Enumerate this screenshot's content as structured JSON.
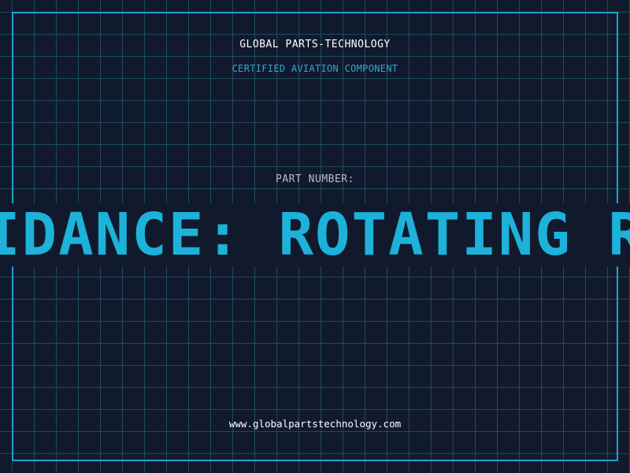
{
  "header": {
    "brand": "GLOBAL PARTS-TECHNOLOGY",
    "subtitle": "CERTIFIED AVIATION COMPONENT"
  },
  "part": {
    "label": "PART NUMBER:",
    "value": "WEATHER AVOIDANCE: ROTATING RADAR SYSTEM"
  },
  "footer": {
    "url": "www.globalpartstechnology.com"
  },
  "colors": {
    "background": "#111a2d",
    "grid": "#1f4a5e",
    "frame": "#1aa3cf",
    "accent": "#1cb2da"
  }
}
